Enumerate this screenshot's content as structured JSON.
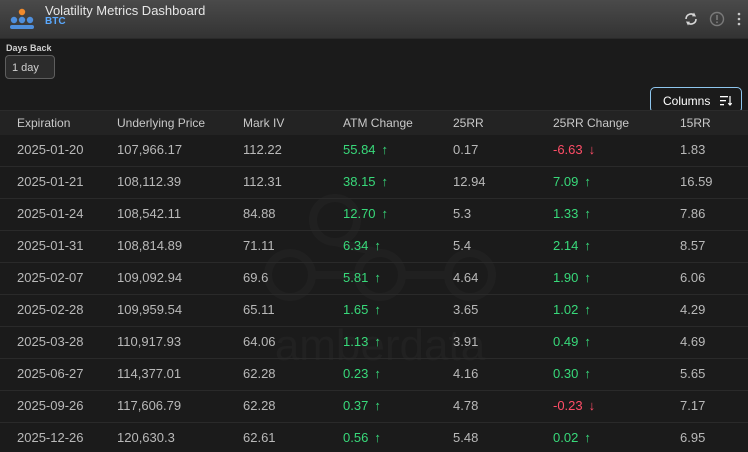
{
  "header": {
    "title": "Volatility Metrics Dashboard",
    "subtitle": "BTC"
  },
  "controls": {
    "days_back_label": "Days Back",
    "days_back_value": "1 day",
    "columns_label": "Columns"
  },
  "table": {
    "columns": [
      "Expiration",
      "Underlying Price",
      "Mark IV",
      "ATM Change",
      "25RR",
      "25RR Change",
      "15RR"
    ],
    "rows": [
      {
        "expiration": "2025-01-20",
        "price": "107,966.17",
        "mark_iv": "112.22",
        "atm_change": "55.84",
        "atm_dir": "up",
        "rr25": "0.17",
        "rr25_change": "-6.63",
        "rr25_dir": "down",
        "rr15": "1.83"
      },
      {
        "expiration": "2025-01-21",
        "price": "108,112.39",
        "mark_iv": "112.31",
        "atm_change": "38.15",
        "atm_dir": "up",
        "rr25": "12.94",
        "rr25_change": "7.09",
        "rr25_dir": "up",
        "rr15": "16.59"
      },
      {
        "expiration": "2025-01-24",
        "price": "108,542.11",
        "mark_iv": "84.88",
        "atm_change": "12.70",
        "atm_dir": "up",
        "rr25": "5.3",
        "rr25_change": "1.33",
        "rr25_dir": "up",
        "rr15": "7.86"
      },
      {
        "expiration": "2025-01-31",
        "price": "108,814.89",
        "mark_iv": "71.11",
        "atm_change": "6.34",
        "atm_dir": "up",
        "rr25": "5.4",
        "rr25_change": "2.14",
        "rr25_dir": "up",
        "rr15": "8.57"
      },
      {
        "expiration": "2025-02-07",
        "price": "109,092.94",
        "mark_iv": "69.6",
        "atm_change": "5.81",
        "atm_dir": "up",
        "rr25": "4.64",
        "rr25_change": "1.90",
        "rr25_dir": "up",
        "rr15": "6.06"
      },
      {
        "expiration": "2025-02-28",
        "price": "109,959.54",
        "mark_iv": "65.11",
        "atm_change": "1.65",
        "atm_dir": "up",
        "rr25": "3.65",
        "rr25_change": "1.02",
        "rr25_dir": "up",
        "rr15": "4.29"
      },
      {
        "expiration": "2025-03-28",
        "price": "110,917.93",
        "mark_iv": "64.06",
        "atm_change": "1.13",
        "atm_dir": "up",
        "rr25": "3.91",
        "rr25_change": "0.49",
        "rr25_dir": "up",
        "rr15": "4.69"
      },
      {
        "expiration": "2025-06-27",
        "price": "114,377.01",
        "mark_iv": "62.28",
        "atm_change": "0.23",
        "atm_dir": "up",
        "rr25": "4.16",
        "rr25_change": "0.30",
        "rr25_dir": "up",
        "rr15": "5.65"
      },
      {
        "expiration": "2025-09-26",
        "price": "117,606.79",
        "mark_iv": "62.28",
        "atm_change": "0.37",
        "atm_dir": "up",
        "rr25": "4.78",
        "rr25_change": "-0.23",
        "rr25_dir": "down",
        "rr15": "7.17"
      },
      {
        "expiration": "2025-12-26",
        "price": "120,630.3",
        "mark_iv": "62.61",
        "atm_change": "0.56",
        "atm_dir": "up",
        "rr25": "5.48",
        "rr25_change": "0.02",
        "rr25_dir": "up",
        "rr15": "6.95"
      }
    ]
  },
  "watermark": {
    "text": "amberdata"
  },
  "icons": {
    "refresh": "refresh-icon",
    "info": "info-icon",
    "more": "more-vertical-icon",
    "columns": "sort-lines-icon",
    "up": "arrow-up-icon",
    "down": "arrow-down-icon"
  },
  "colors": {
    "positive": "#38d97a",
    "negative": "#ff4d67",
    "accent": "#5aa9ff",
    "button_border": "#8ec6ee"
  }
}
